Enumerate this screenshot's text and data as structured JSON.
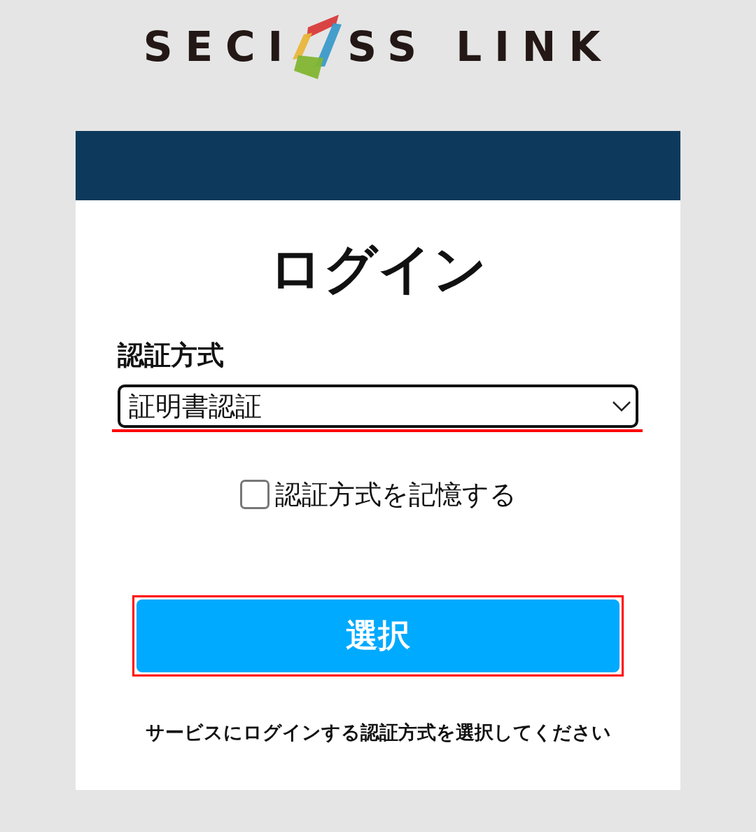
{
  "logo": {
    "text_before": "SECI",
    "text_after": "SS LINK"
  },
  "card": {
    "title": "ログイン",
    "method_label": "認証方式",
    "method_select": {
      "value": "証明書認証",
      "highlighted": true
    },
    "remember": {
      "label": "認証方式を記憶する",
      "checked": false
    },
    "select_button": {
      "label": "選択",
      "highlighted": true
    },
    "hint": "サービスにログインする認証方式を選択してください"
  }
}
